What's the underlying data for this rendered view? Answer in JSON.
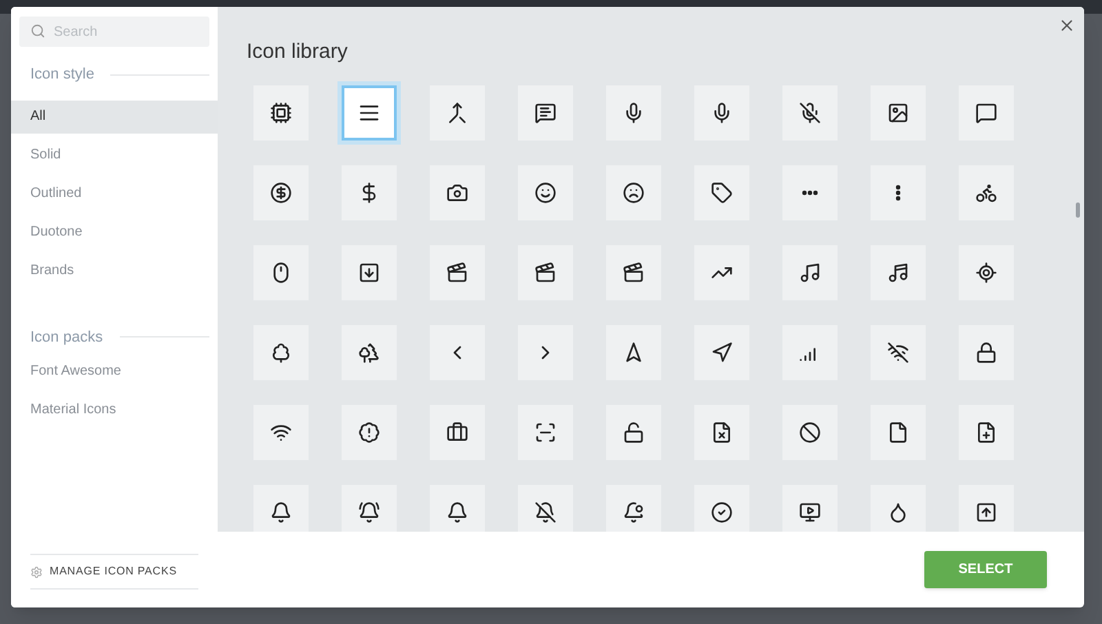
{
  "search": {
    "placeholder": "Search"
  },
  "icon_style": {
    "heading": "Icon style",
    "items": [
      {
        "label": "All",
        "selected": true
      },
      {
        "label": "Solid",
        "selected": false
      },
      {
        "label": "Outlined",
        "selected": false
      },
      {
        "label": "Duotone",
        "selected": false
      },
      {
        "label": "Brands",
        "selected": false
      }
    ]
  },
  "icon_packs": {
    "heading": "Icon packs",
    "items": [
      {
        "label": "Font Awesome",
        "selected": false
      },
      {
        "label": "Material Icons",
        "selected": false
      }
    ]
  },
  "manage_button": {
    "label": "MANAGE ICON PACKS"
  },
  "title": "Icon library",
  "icons": [
    {
      "selected": false
    },
    {
      "selected": true
    },
    {
      "selected": false
    },
    {
      "selected": false
    },
    {
      "selected": false
    },
    {
      "selected": false
    },
    {
      "selected": false
    },
    {
      "selected": false
    },
    {
      "selected": false
    },
    {
      "selected": false
    },
    {
      "selected": false
    },
    {
      "selected": false
    },
    {
      "selected": false
    },
    {
      "selected": false
    },
    {
      "selected": false
    },
    {
      "selected": false
    },
    {
      "selected": false
    },
    {
      "selected": false
    },
    {
      "selected": false
    },
    {
      "selected": false
    },
    {
      "selected": false
    },
    {
      "selected": false
    },
    {
      "selected": false
    },
    {
      "selected": false
    },
    {
      "selected": false
    },
    {
      "selected": false
    },
    {
      "selected": false
    },
    {
      "selected": false
    },
    {
      "selected": false
    },
    {
      "selected": false
    },
    {
      "selected": false
    },
    {
      "selected": false
    },
    {
      "selected": false
    },
    {
      "selected": false
    },
    {
      "selected": false
    },
    {
      "selected": false
    },
    {
      "selected": false
    },
    {
      "selected": false
    },
    {
      "selected": false
    },
    {
      "selected": false
    },
    {
      "selected": false
    },
    {
      "selected": false
    },
    {
      "selected": false
    },
    {
      "selected": false
    },
    {
      "selected": false
    },
    {
      "selected": false
    },
    {
      "selected": false
    },
    {
      "selected": false
    },
    {
      "selected": false
    },
    {
      "selected": false
    },
    {
      "selected": false
    },
    {
      "selected": false
    },
    {
      "selected": false
    },
    {
      "selected": false
    }
  ],
  "select_button": {
    "label": "SELECT"
  }
}
